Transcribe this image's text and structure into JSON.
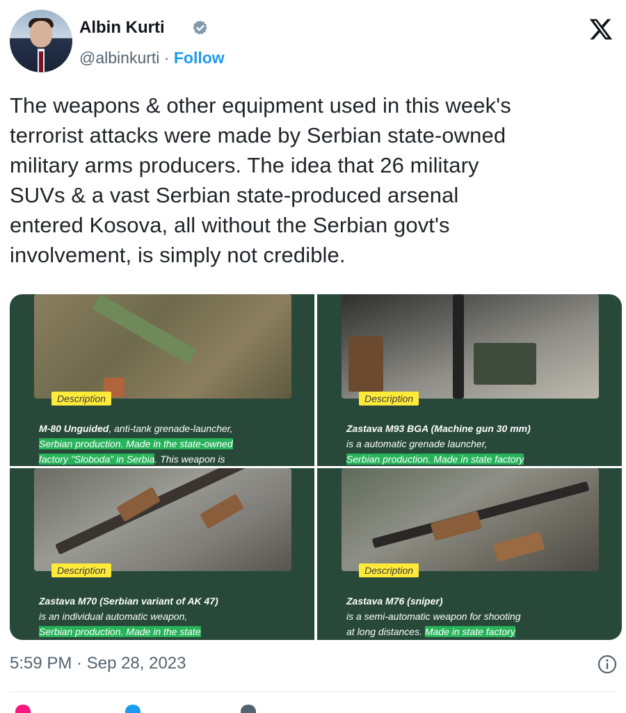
{
  "author": {
    "name": "Albin Kurti",
    "handle": "@albinkurti",
    "separator": "·",
    "follow_label": "Follow",
    "verified_color": "#829aab"
  },
  "brand_icon": "x-logo",
  "tweet": {
    "lines": [
      "The weapons & other equipment used in this week's",
      "terrorist attacks were made by Serbian state-owned",
      "military arms producers. The idea that 26 military",
      "SUVs & a vast Serbian state-produced arsenal",
      "entered Kosova, all without the Serbian govt's",
      "involvement, is simply not credible."
    ]
  },
  "media": [
    {
      "tag": "Description",
      "title": "M-80 Unguided",
      "line1_rest": ", anti-tank grenade-launcher,",
      "line2_highlight": "Serbian production. Made in the state-owned",
      "line3_highlight": "factory \"Sloboda\" in Serbia",
      "line3_rest": ". This weapon is"
    },
    {
      "tag": "Description",
      "title": "Zastava M93 BGA (Machine gun 30 mm)",
      "line2": "is a automatic grenade launcher,",
      "line3_highlight": "Serbian production. Made in state factory"
    },
    {
      "tag": "Description",
      "title": "Zastava M70 (Serbian variant of AK 47)",
      "line2": "is an individual automatic weapon,",
      "line3_highlight": "Serbian production. Made in the state"
    },
    {
      "tag": "Description",
      "title": "Zastava M76 (sniper)",
      "line2": "is a semi-automatic weapon for shooting",
      "line3_plain": "at long distances.",
      "line3_highlight": "Made in state factory"
    }
  ],
  "footer": {
    "timestamp": "5:59 PM · Sep 28, 2023",
    "info_icon": "info-icon"
  },
  "colors": {
    "link": "#1d9bf0",
    "tile_bg": "#28493a",
    "highlight": "#27b35a",
    "tag": "#ffea3a"
  }
}
